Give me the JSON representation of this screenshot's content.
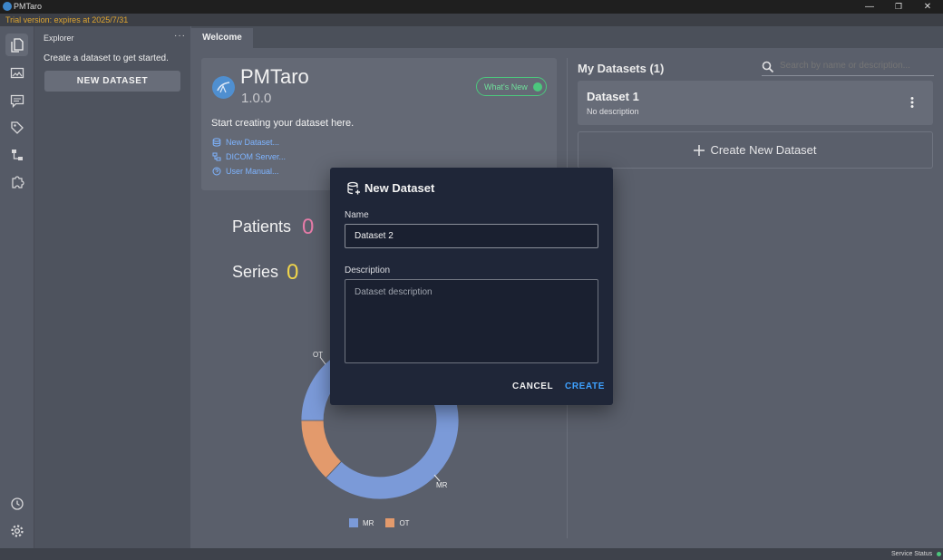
{
  "titlebar": {
    "title": "PMTaro",
    "minimize": "—",
    "restore": "❐",
    "close": "✕"
  },
  "trial": {
    "text": "Trial version: expires at 2025/7/31"
  },
  "activity": {
    "items": [
      {
        "name": "explorer",
        "icon": "files-icon"
      },
      {
        "name": "viewer",
        "icon": "image-viewer-icon"
      },
      {
        "name": "comments",
        "icon": "comments-icon"
      },
      {
        "name": "labels",
        "icon": "tag-icon"
      },
      {
        "name": "workflow",
        "icon": "workflow-icon"
      },
      {
        "name": "extensions",
        "icon": "puzzle-icon"
      }
    ],
    "bottom": [
      {
        "name": "history",
        "icon": "history-icon"
      },
      {
        "name": "settings",
        "icon": "gear-icon"
      }
    ]
  },
  "explorer": {
    "title": "Explorer",
    "more": "···",
    "hint": "Create a dataset to get started.",
    "new_dataset_label": "NEW DATASET"
  },
  "tabs": [
    {
      "label": "Welcome"
    }
  ],
  "welcome": {
    "app_name": "PMTaro",
    "version": "1.0.0",
    "whats_new": "What's New",
    "start_text": "Start creating your dataset here.",
    "links": [
      {
        "label": "New Dataset..."
      },
      {
        "label": "DICOM Server..."
      },
      {
        "label": "User Manual..."
      }
    ]
  },
  "stats": {
    "patients_label": "Patients",
    "patients_value": "0",
    "series_label": "Series",
    "series_value": "0"
  },
  "chart_data": {
    "type": "pie",
    "categories": [
      "MR",
      "OT"
    ],
    "values": [
      87,
      13
    ],
    "colors": [
      "#7b9ad8",
      "#e39a6c"
    ],
    "legend": [
      "MR",
      "OT"
    ],
    "legend_position": "bottom"
  },
  "datasets": {
    "title": "My Datasets (1)",
    "search_placeholder": "Search by name or description...",
    "items": [
      {
        "name": "Dataset 1",
        "description": "No description"
      }
    ],
    "create_label": "Create New Dataset"
  },
  "dialog": {
    "title": "New Dataset",
    "name_label": "Name",
    "name_value": "Dataset 2",
    "description_label": "Description",
    "description_placeholder": "Dataset description",
    "cancel_label": "CANCEL",
    "create_label": "CREATE"
  },
  "status": {
    "text": "Service Status"
  },
  "colors": {
    "accent": "#3ea1ff",
    "link": "#7eb4ff",
    "patients": "#e67ca8",
    "series": "#f0d54b",
    "whats_new": "#4cc77d",
    "trial": "#e0a630"
  }
}
